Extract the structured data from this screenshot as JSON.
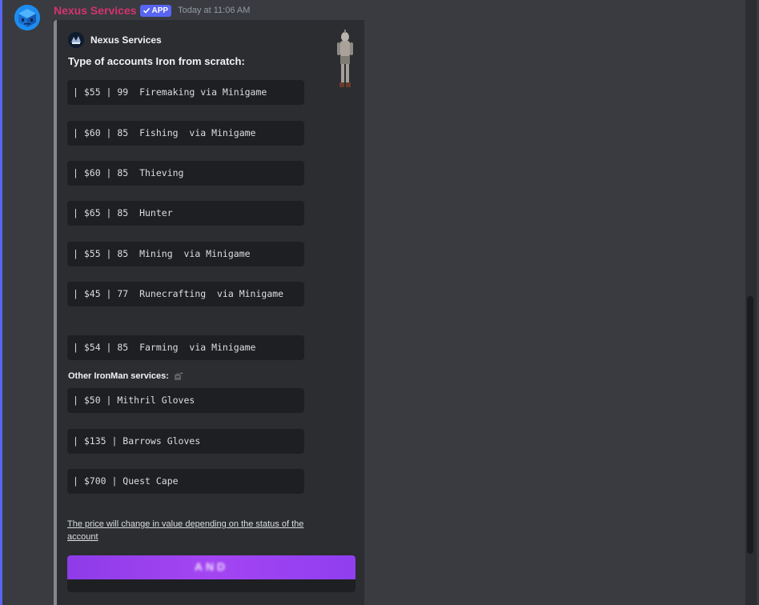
{
  "message": {
    "username": "Nexus Services",
    "badge_label": "APP",
    "timestamp": "Today at 11:06 AM",
    "username_color": "#d6336c",
    "badge_color": "#5865f2",
    "avatar_icon": "blue-robot-cube-icon"
  },
  "embed": {
    "author_name": "Nexus Services",
    "author_icon": "nexus-logo-icon",
    "thumbnail": "armored-character-sprite",
    "title": "Type of accounts Iron from scratch:",
    "accounts": [
      "| $55 | 99  Firemaking via Minigame",
      "| $60 | 85  Fishing  via Minigame",
      "| $60 | 85  Thieving",
      "| $65 | 85  Hunter",
      "| $55 | 85  Mining  via Minigame",
      "| $45 | 77  Runecrafting  via Minigame",
      "| $54 | 85  Farming  via Minigame"
    ],
    "other_label": "Other IronMan services:",
    "other_icon": "iron-helmet-icon",
    "services": [
      "| $50 | Mithril Gloves",
      "| $135 | Barrows Gloves",
      "| $700 | Quest Cape"
    ],
    "footnote": "The price will change in value depending on the status of the account",
    "image_banner_text": "AND",
    "image_banner_color": "#a445f2"
  }
}
